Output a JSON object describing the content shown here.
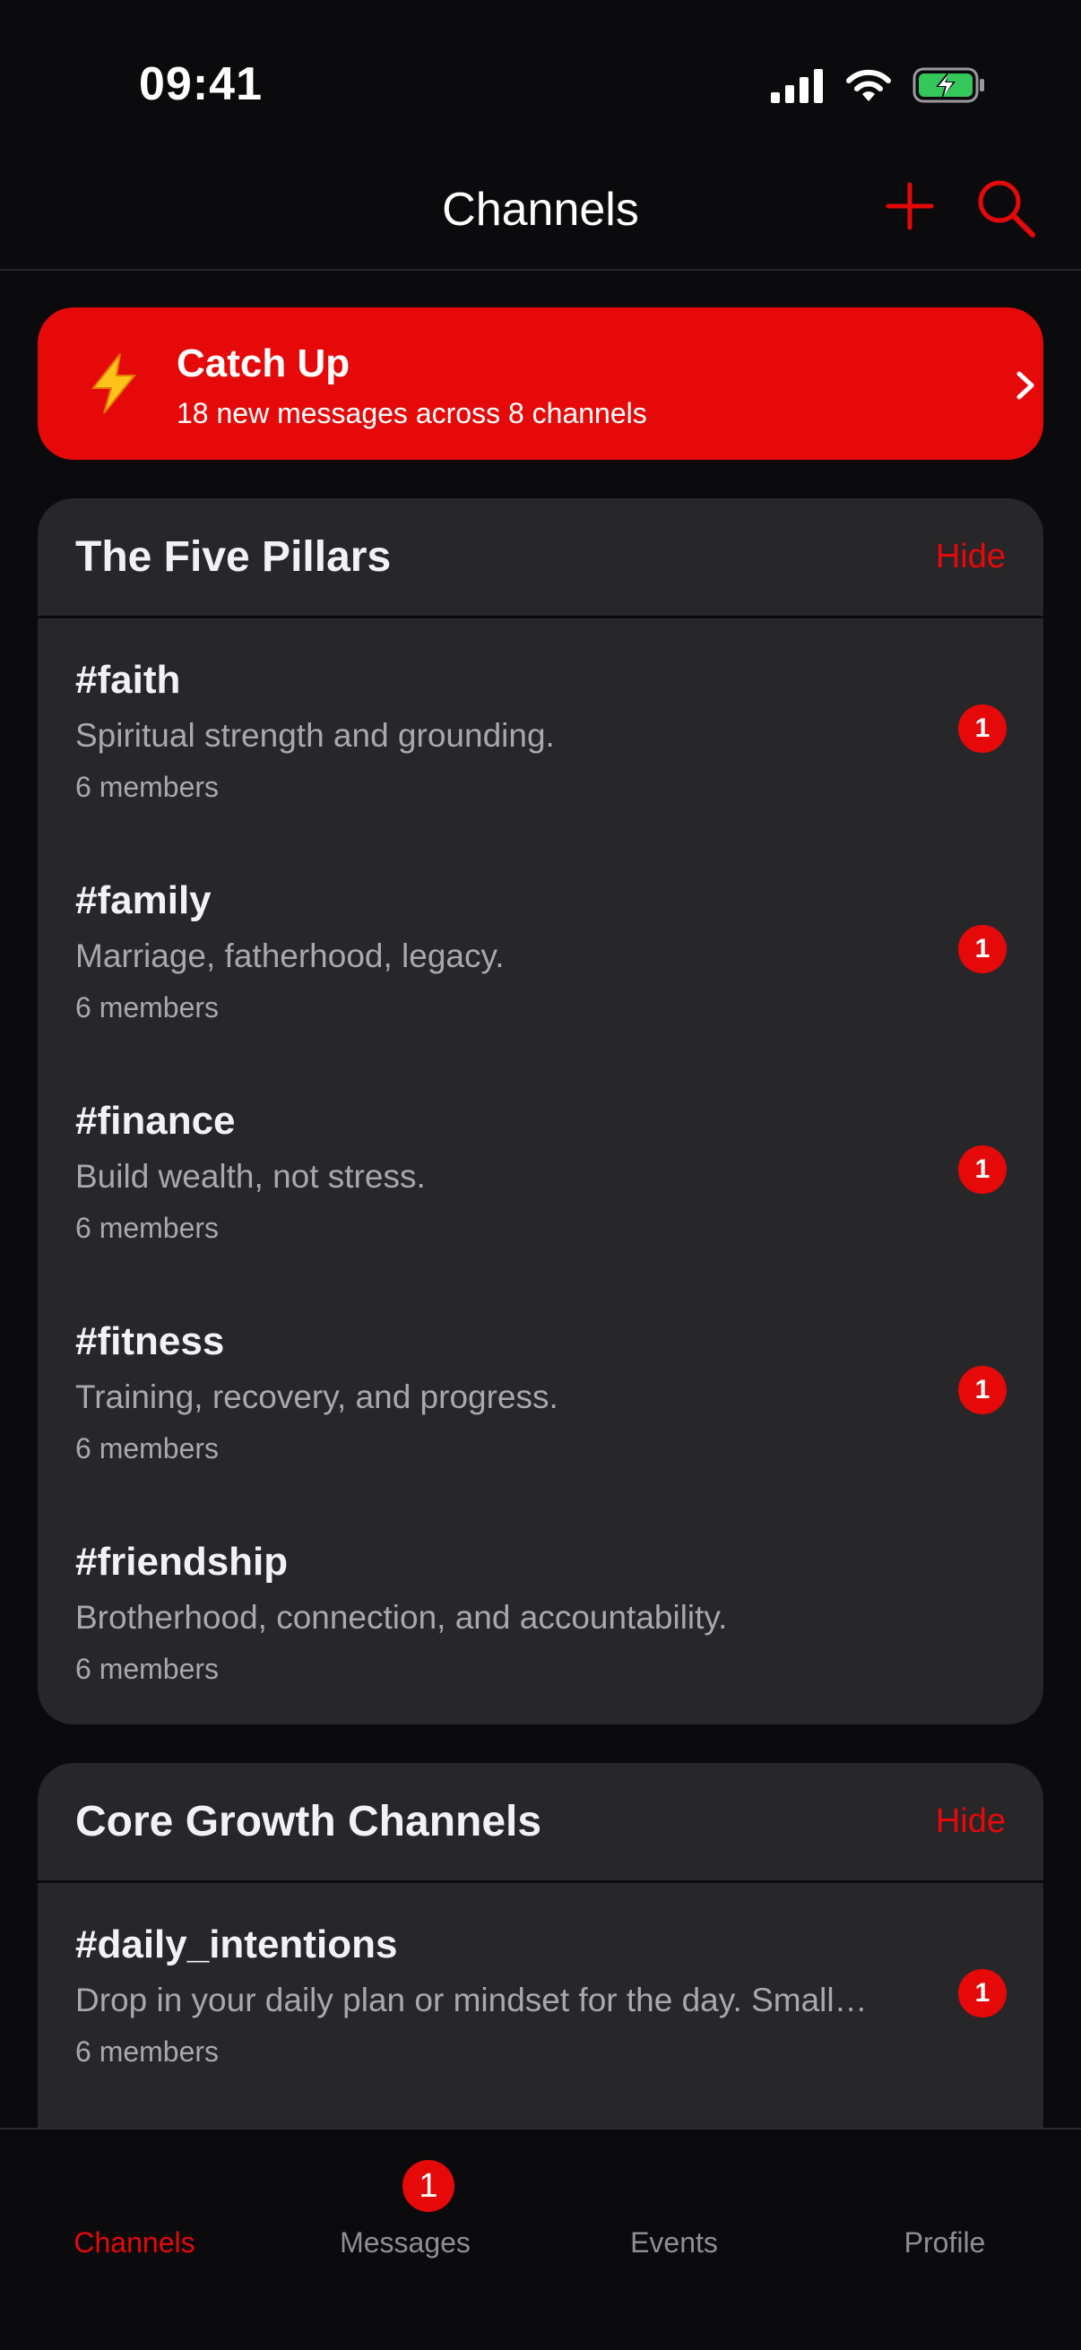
{
  "status_bar": {
    "time": "09:41",
    "icons": [
      "cellular-signal-icon",
      "wifi-icon",
      "battery-charging-icon"
    ]
  },
  "header": {
    "title": "Channels",
    "add_icon": "plus-icon",
    "search_icon": "search-icon"
  },
  "catch_up": {
    "title": "Catch Up",
    "subtitle": "18 new messages across 8 channels",
    "icon": "lightning-bolt-icon"
  },
  "sections": [
    {
      "title": "The Five Pillars",
      "hide_label": "Hide",
      "channels": [
        {
          "name": "#faith",
          "description": "Spiritual strength and grounding.",
          "members": "6 members",
          "unread": "1"
        },
        {
          "name": "#family",
          "description": "Marriage, fatherhood, legacy.",
          "members": "6 members",
          "unread": "1"
        },
        {
          "name": "#finance",
          "description": "Build wealth, not stress.",
          "members": "6 members",
          "unread": "1"
        },
        {
          "name": "#fitness",
          "description": "Training, recovery, and progress.",
          "members": "6 members",
          "unread": "1"
        },
        {
          "name": "#friendship",
          "description": "Brotherhood, connection, and accountability.",
          "members": "6 members",
          "unread": ""
        }
      ]
    },
    {
      "title": "Core Growth Channels",
      "hide_label": "Hide",
      "channels": [
        {
          "name": "#daily_intentions",
          "description": "Drop in your daily plan or mindset for the day. Small…",
          "members": "6 members",
          "unread": "1"
        }
      ]
    }
  ],
  "tab_bar": {
    "tabs": [
      {
        "label": "Channels",
        "active": true
      },
      {
        "label": "Messages",
        "active": false,
        "badge": "1"
      },
      {
        "label": "Events",
        "active": false
      },
      {
        "label": "Profile",
        "active": false
      }
    ]
  },
  "colors": {
    "background": "#0b0b0d",
    "card": "#27272a",
    "accent": "#e50909",
    "secondary_text": "#a8a8ad",
    "tab_inactive": "#8e8e93"
  }
}
